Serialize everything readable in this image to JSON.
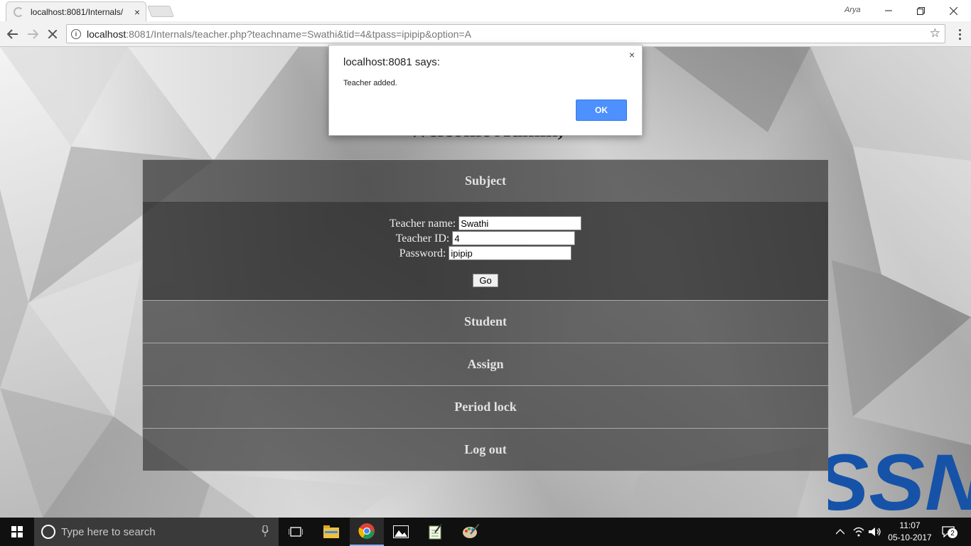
{
  "browser": {
    "tab_title": "localhost:8081/Internals/",
    "tab_close": "×",
    "profile_name": "Arya",
    "url_host": "localhost",
    "url_rest": ":8081/Internals/teacher.php?teachname=Swathi&tid=4&tpass=ipipip&option=A"
  },
  "page": {
    "welcome": "Welcome Admin,",
    "menu": {
      "subject": "Subject",
      "student": "Student",
      "assign": "Assign",
      "period_lock": "Period lock",
      "logout": "Log out"
    },
    "form": {
      "teacher_name_label": "Teacher name:",
      "teacher_name_value": "Swathi",
      "teacher_id_label": "Teacher ID:",
      "teacher_id_value": "4",
      "password_label": "Password:",
      "password_value": "ipipip",
      "go_label": "Go"
    },
    "logo_text": "SSN"
  },
  "dialog": {
    "title": "localhost:8081 says:",
    "message": "Teacher added.",
    "ok_label": "OK",
    "close": "×"
  },
  "taskbar": {
    "search_placeholder": "Type here to search",
    "time": "11:07",
    "date": "05-10-2017",
    "notification_count": "2"
  },
  "colors": {
    "ok_button": "#4d90fe",
    "menu_bg": "#3c3c3c",
    "logo_blue": "#1653a8",
    "taskbar": "#101010"
  }
}
